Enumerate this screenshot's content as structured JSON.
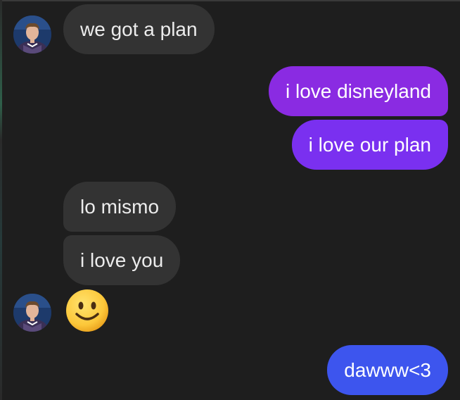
{
  "messages": [
    {
      "text": "we got a plan"
    },
    {
      "text": "i love disneyland"
    },
    {
      "text": "i love our plan"
    },
    {
      "text": "lo mismo"
    },
    {
      "text": "i love you"
    },
    {
      "emoji": "slightly-smiling-face"
    },
    {
      "text": "dawww<3"
    }
  ],
  "colors": {
    "background": "#1e1e1e",
    "incoming_bubble": "#333333",
    "outgoing_purple": "#8a2be2",
    "outgoing_violet": "#7a30f0",
    "outgoing_blue": "#3d55ee"
  }
}
